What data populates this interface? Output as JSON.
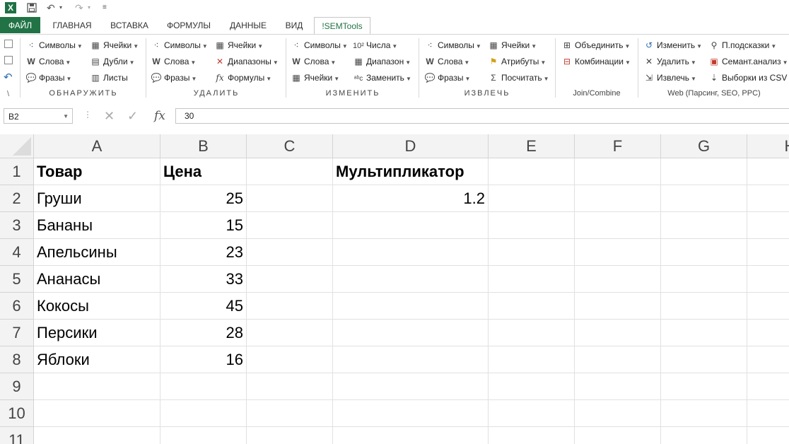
{
  "tabs": [
    {
      "id": "file",
      "label": "ФАЙЛ"
    },
    {
      "id": "home",
      "label": "ГЛАВНАЯ"
    },
    {
      "id": "insert",
      "label": "ВСТАВКА"
    },
    {
      "id": "formulas",
      "label": "ФОРМУЛЫ"
    },
    {
      "id": "data",
      "label": "ДАННЫЕ"
    },
    {
      "id": "view",
      "label": "ВИД"
    },
    {
      "id": "semtools",
      "label": "!SEMTools"
    }
  ],
  "ribbon": {
    "detect": {
      "label": "ОБНАРУЖИТЬ",
      "symbols": "Символы",
      "words": "Слова",
      "phrases": "Фразы",
      "cells": "Ячейки",
      "duplicates": "Дубли",
      "sheets": "Листы"
    },
    "remove": {
      "label": "УДАЛИТЬ",
      "symbols": "Символы",
      "words": "Слова",
      "phrases": "Фразы",
      "cells": "Ячейки",
      "ranges": "Диапазоны",
      "formulas": "Формулы"
    },
    "change": {
      "label": "ИЗМЕНИТЬ",
      "symbols": "Символы",
      "words": "Слова",
      "cells": "Ячейки",
      "numbers": "Числа",
      "range": "Диапазон",
      "replace": "Заменить"
    },
    "extract": {
      "label": "ИЗВЛЕЧЬ",
      "symbols": "Символы",
      "words": "Слова",
      "phrases": "Фразы",
      "cells": "Ячейки",
      "attributes": "Атрибуты",
      "count": "Посчитать"
    },
    "join": {
      "label": "Join/Combine",
      "merge": "Объединить",
      "combinations": "Комбинации"
    },
    "web": {
      "label": "Web (Парсинг, SEO, PPC)",
      "modify": "Изменить",
      "delete": "Удалить",
      "extract": "Извлечь",
      "hints": "П.подсказки",
      "semantic": "Семант.анализ",
      "csv": "Выборки из CSV"
    }
  },
  "formula_bar": {
    "name_box": "B2",
    "value": "30"
  },
  "columns": [
    "A",
    "B",
    "C",
    "D",
    "E",
    "F",
    "G",
    "H"
  ],
  "rows": [
    "1",
    "2",
    "3",
    "4",
    "5",
    "6",
    "7",
    "8",
    "9",
    "10",
    "11"
  ],
  "cells": {
    "A1": "Товар",
    "B1": "Цена",
    "D1": "Мультипликатор",
    "A2": "Груши",
    "B2": "25",
    "D2": "1.2",
    "A3": "Бананы",
    "B3": "15",
    "A4": "Апельсины",
    "B4": "23",
    "A5": "Ананасы",
    "B5": "33",
    "A6": "Кокосы",
    "B6": "45",
    "A7": "Персики",
    "B7": "28",
    "A8": "Яблоки",
    "B8": "16"
  }
}
